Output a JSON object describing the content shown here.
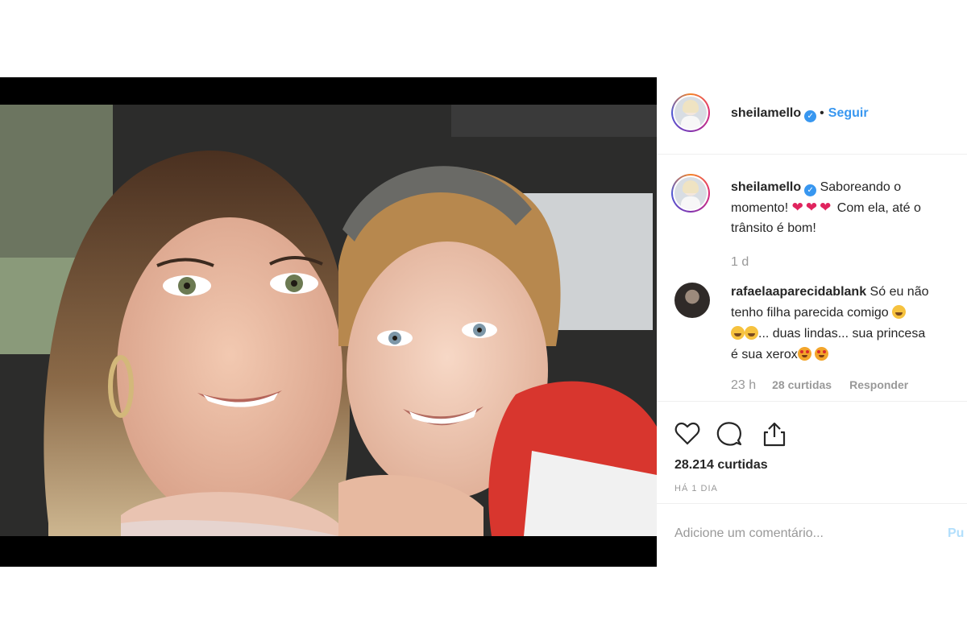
{
  "post": {
    "author": "sheilamello",
    "follow_dot": "•",
    "follow_label": "Seguir",
    "caption_line1": "Saboreando o",
    "caption_line2": "momento!",
    "caption_line2b": "Com ela, até o",
    "caption_line3": "trânsito é bom!",
    "caption_time": "1 d",
    "likes_count": "28.214 curtidas",
    "post_age": "HÁ 1 DIA"
  },
  "comment": {
    "author": "rafaelaaparecidablank",
    "line1": "Só eu não",
    "line2": "tenho filha parecida comigo",
    "line3": "... duas lindas... sua princesa",
    "line4": "é sua xerox",
    "age": "23 h",
    "likes": "28 curtidas",
    "reply": "Responder"
  },
  "add_comment": {
    "placeholder": "Adicione um comentário...",
    "publish": "Pu"
  },
  "icons": {
    "verified": "verified-badge",
    "like": "heart-outline-icon",
    "comment": "speech-bubble-icon",
    "share": "share-icon"
  },
  "colors": {
    "link_blue": "#3897f0",
    "verified_blue": "#3897f0",
    "muted": "#999999",
    "text": "#262626",
    "divider": "#efefef"
  }
}
